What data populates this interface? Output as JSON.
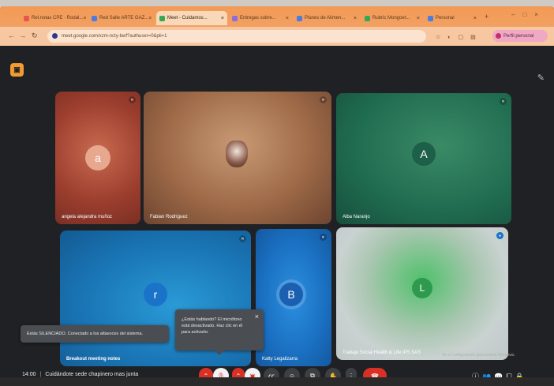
{
  "browser": {
    "tabs": [
      {
        "label": "Rel.notas CPE · Rodal...",
        "color": "#e8554e",
        "active": false
      },
      {
        "label": "Red Salle ARTE GAZ...",
        "color": "#4a7de0",
        "active": false
      },
      {
        "label": "Meet - Cuidamos...",
        "color": "#34a853",
        "active": true
      },
      {
        "label": "Entregas sobre...",
        "color": "#8a6de0",
        "active": false
      },
      {
        "label": "Planes de Alimen...",
        "color": "#4a7de0",
        "active": false
      },
      {
        "label": "Rubric Mongoet...",
        "color": "#34a853",
        "active": false
      },
      {
        "label": "Personal",
        "color": "#4a7de0",
        "active": false
      }
    ],
    "url": "meet.google.com/xzm-ncty-bwf?authuser=0&pli=1",
    "profile_label": "Perfil personal"
  },
  "meet": {
    "corner_icon": "pencil-icon",
    "participants": [
      {
        "name": "angela alejandra muñoz",
        "initial": "a",
        "avatar_color": "#e7a88e",
        "text_color": "#ffffff"
      },
      {
        "name": "Fabian Rodríguez",
        "initial": "",
        "avatar_color": "",
        "text_color": ""
      },
      {
        "name": "Alba Naranjo",
        "initial": "A",
        "avatar_color": "#1e5f4a",
        "text_color": "#ffffff"
      },
      {
        "name": "Breakout meeting notes",
        "initial": "r",
        "avatar_color": "#1a73c8",
        "text_color": "#ffffff"
      },
      {
        "name": "Katty Legalizarra",
        "initial": "B",
        "avatar_color": "#1a5fb0",
        "text_color": "#ffffff"
      },
      {
        "name": "Trabajo Social Health & Life IPS SAS",
        "initial": "L",
        "avatar_color": "#2e9a4e",
        "text_color": "#ffffff"
      }
    ],
    "toast_mute": "Estás SILENCIADO. Conectado a los altavoces del sistema.",
    "toast_talking": "¿Estás hablando? El micrófono está desactivado. Haz clic en él para activarlo.",
    "time": "14:00",
    "meeting_title": "Cuidándote sede chapinero mas junta",
    "activate_windows": "Activar Windows",
    "activate_windows_sub": "Ve a Configuración para activar Windows."
  }
}
